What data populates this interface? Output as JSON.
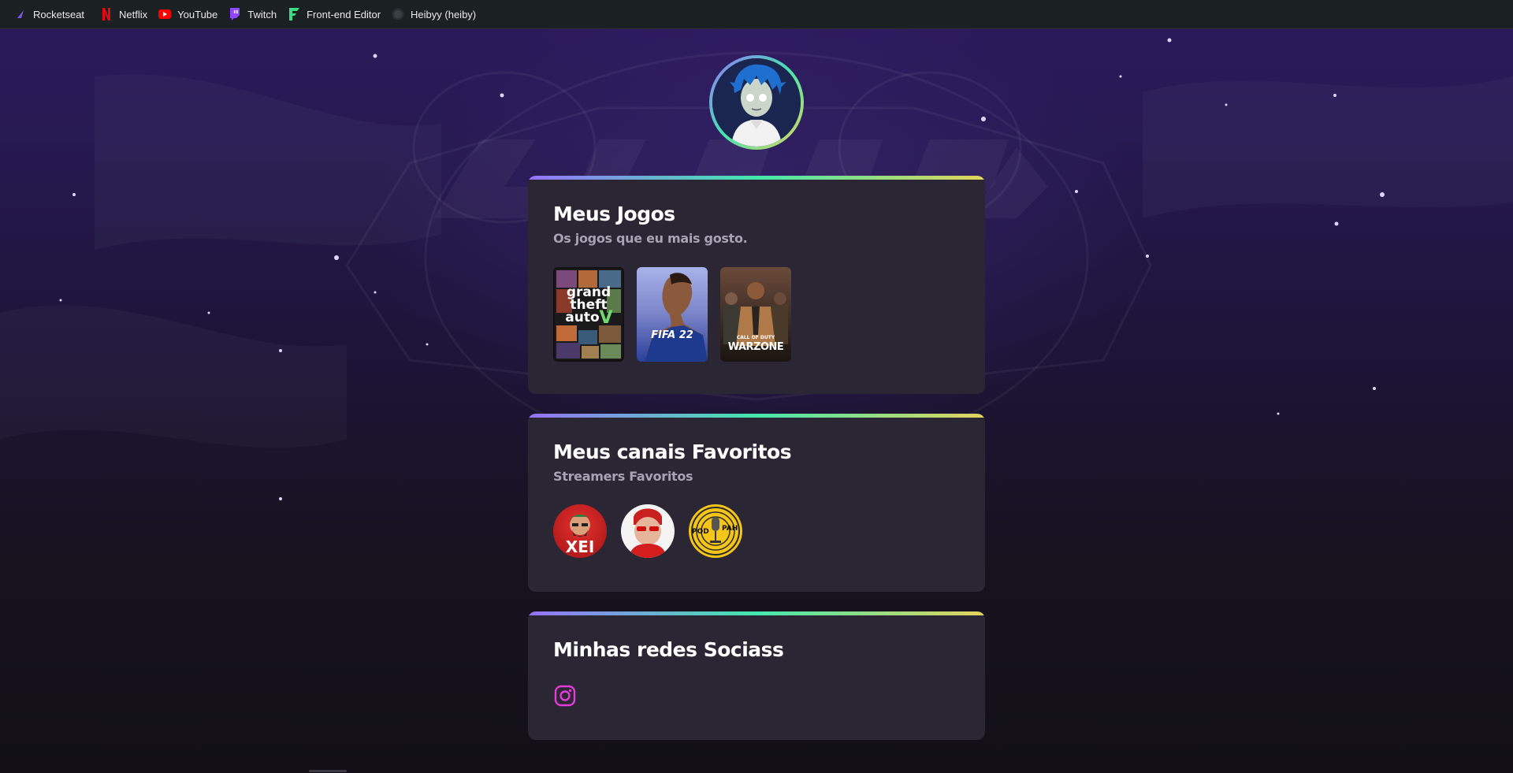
{
  "bookmarks": [
    {
      "label": "Rocketseat",
      "icon": "rocketseat-icon"
    },
    {
      "label": "Netflix",
      "icon": "netflix-icon"
    },
    {
      "label": "YouTube",
      "icon": "youtube-icon"
    },
    {
      "label": "Twitch",
      "icon": "twitch-icon"
    },
    {
      "label": "Front-end Editor",
      "icon": "frontend-editor-icon"
    },
    {
      "label": "Heibyy (heiby)",
      "icon": "github-avatar-icon"
    }
  ],
  "games_card": {
    "title": "Meus Jogos",
    "subtitle": "Os jogos que eu mais gosto.",
    "games": [
      {
        "name": "grand theft auto V",
        "line1": "grand",
        "line2": "theft",
        "line3": "auto",
        "mark": "V"
      },
      {
        "name": "FIFA 22",
        "label": "FIFA 22"
      },
      {
        "name": "Call of Duty Warzone",
        "small": "CALL OF DUTY",
        "label": "WARZONE"
      }
    ]
  },
  "channels_card": {
    "title": "Meus canais Favoritos",
    "subtitle": "Streamers Favoritos",
    "channels": [
      {
        "name": "xei",
        "label": "XEI"
      },
      {
        "name": "streamer-red"
      },
      {
        "name": "podpah",
        "label_left": "POD",
        "label_right": "PAH"
      }
    ]
  },
  "social_card": {
    "title": "Minhas redes Sociass",
    "links": [
      {
        "icon": "instagram-icon",
        "color": "#e23bd8"
      }
    ]
  },
  "colors": {
    "gradient_start": "#9572fc",
    "gradient_mid": "#43e7ad",
    "gradient_end": "#e2d45c",
    "card_bg": "#2a2634"
  }
}
